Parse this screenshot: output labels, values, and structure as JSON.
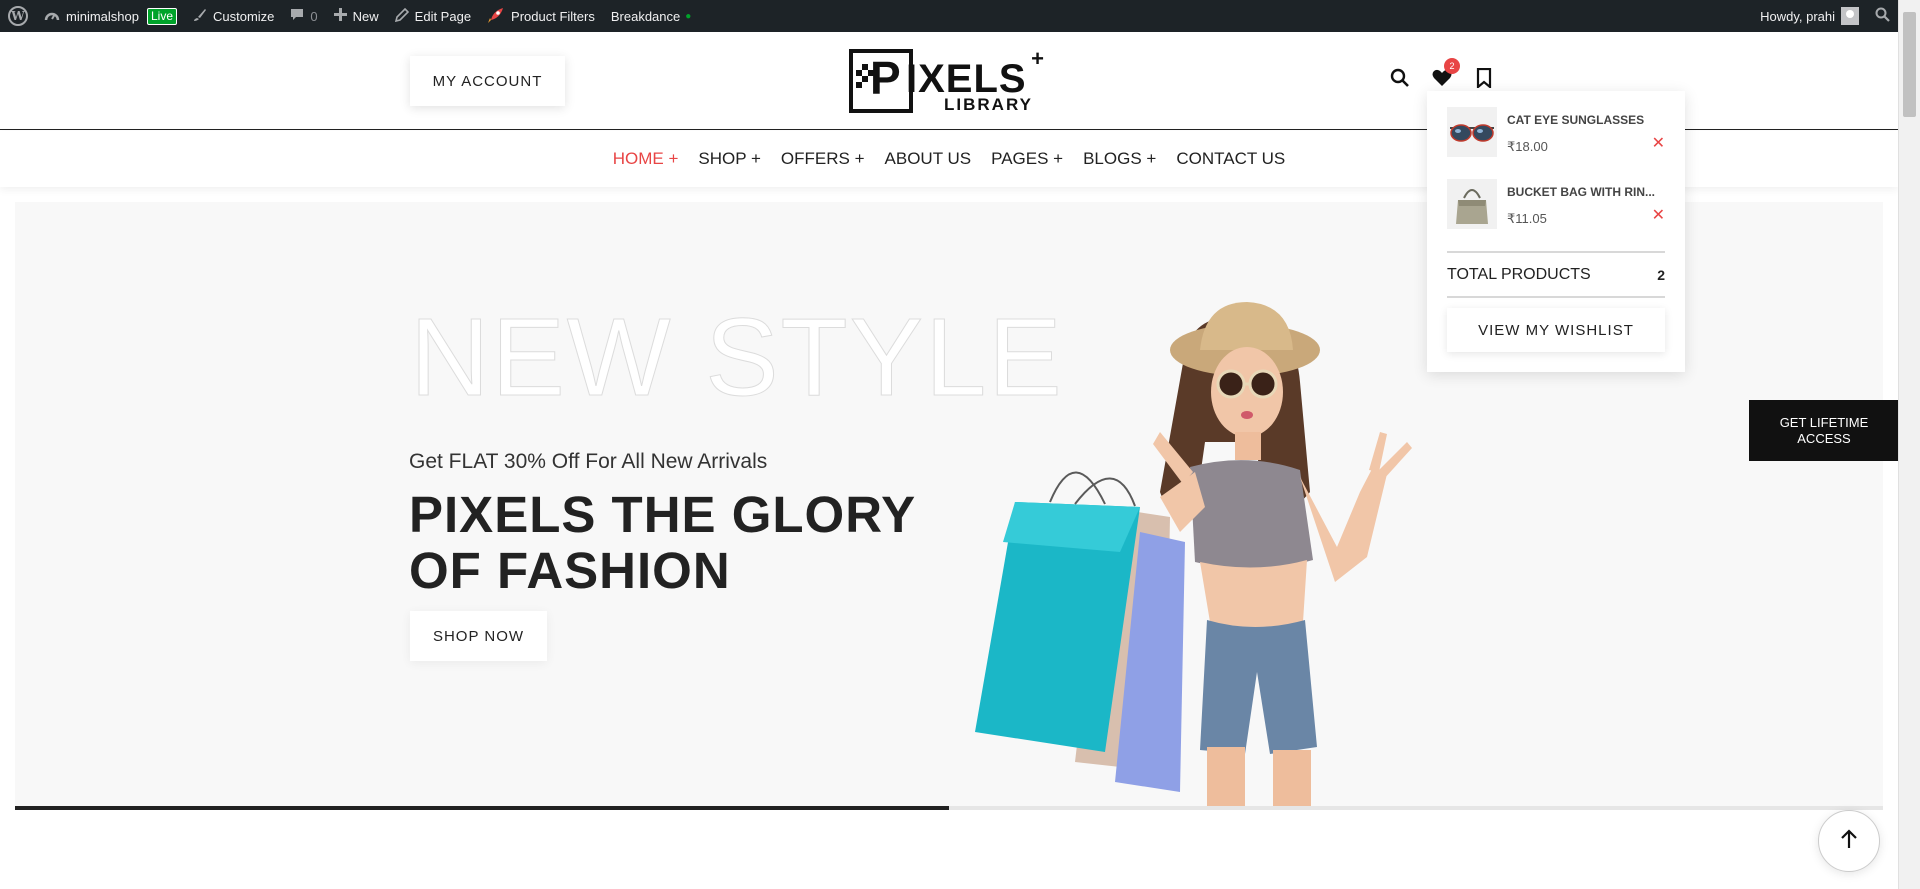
{
  "admin_bar": {
    "site_name": "minimalshop",
    "live_badge": "Live",
    "customize": "Customize",
    "comments_count": "0",
    "new": "New",
    "edit_page": "Edit Page",
    "product_filters": "Product Filters",
    "breakdance": "Breakdance",
    "greeting": "Howdy, prahi"
  },
  "header": {
    "my_account": "MY ACCOUNT",
    "logo_text": "PIXELS LIBRARY",
    "wishlist_count": "2"
  },
  "nav": {
    "items": [
      {
        "label": "HOME +"
      },
      {
        "label": "SHOP +"
      },
      {
        "label": "OFFERS +"
      },
      {
        "label": "ABOUT US"
      },
      {
        "label": "PAGES +"
      },
      {
        "label": "BLOGS +"
      },
      {
        "label": "CONTACT US"
      }
    ]
  },
  "hero": {
    "big_text": "NEW STYLE",
    "subtitle": "Get FLAT 30% Off For All New Arrivals",
    "title": "PIXELS THE GLORY OF FASHION",
    "shop_button": "SHOP NOW",
    "slide_progress": 0.5
  },
  "wishlist": {
    "items": [
      {
        "name": "CAT EYE SUNGLASSES",
        "price": "₹18.00"
      },
      {
        "name": "BUCKET BAG WITH RIN...",
        "price": "₹11.05"
      }
    ],
    "total_label": "TOTAL PRODUCTS",
    "total_count": "2",
    "view_button": "VIEW MY WISHLIST"
  },
  "floating": {
    "lifetime_line1": "GET LIFETIME",
    "lifetime_line2": "ACCESS"
  },
  "colors": {
    "accent": "#e84545",
    "admin_bar_bg": "#1d2327",
    "live_green": "#00a32a"
  }
}
